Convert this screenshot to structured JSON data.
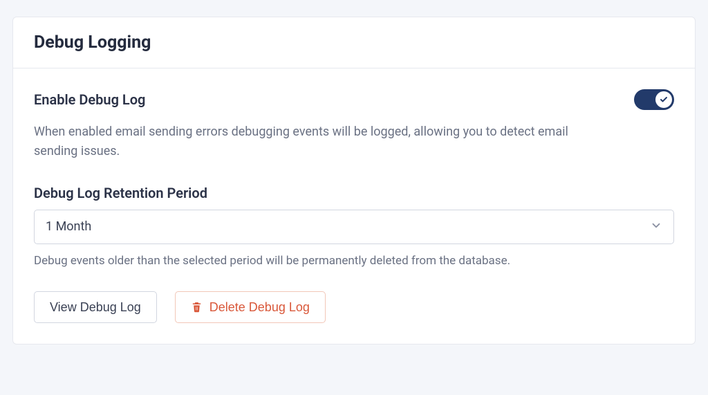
{
  "card": {
    "title": "Debug Logging"
  },
  "enable": {
    "label": "Enable Debug Log",
    "description": "When enabled email sending errors debugging events will be logged, allowing you to detect email sending issues.",
    "value": true
  },
  "retention": {
    "label": "Debug Log Retention Period",
    "selected": "1 Month",
    "hint": "Debug events older than the selected period will be permanently deleted from the database."
  },
  "buttons": {
    "view": "View Debug Log",
    "delete": "Delete Debug Log"
  }
}
